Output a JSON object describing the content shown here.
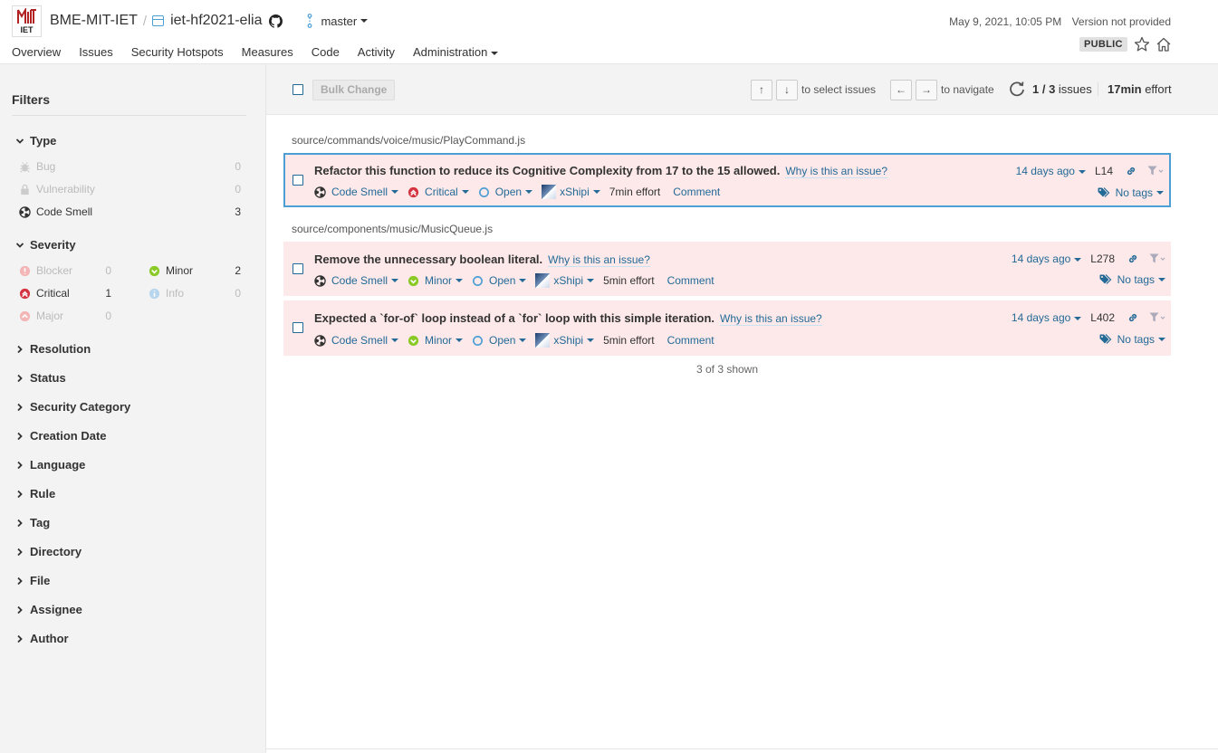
{
  "header": {
    "logo_text": "IET",
    "org": "BME-MIT-IET",
    "separator": "/",
    "project": "iet-hf2021-elia",
    "branch": "master",
    "date": "May 9, 2021, 10:05 PM",
    "version": "Version not provided",
    "visibility": "PUBLIC"
  },
  "nav": {
    "tabs": [
      "Overview",
      "Issues",
      "Security Hotspots",
      "Measures",
      "Code",
      "Activity",
      "Administration"
    ],
    "active": "Issues"
  },
  "sidebar": {
    "title": "Filters",
    "type": {
      "label": "Type",
      "items": [
        {
          "label": "Bug",
          "count": "0",
          "icon": "bug-icon"
        },
        {
          "label": "Vulnerability",
          "count": "0",
          "icon": "lock-icon"
        },
        {
          "label": "Code Smell",
          "count": "3",
          "icon": "code-smell-icon"
        }
      ]
    },
    "severity": {
      "label": "Severity",
      "items": [
        {
          "label": "Blocker",
          "count": "0"
        },
        {
          "label": "Minor",
          "count": "2"
        },
        {
          "label": "Critical",
          "count": "1"
        },
        {
          "label": "Info",
          "count": "0"
        },
        {
          "label": "Major",
          "count": "0"
        }
      ]
    },
    "collapsed": [
      "Resolution",
      "Status",
      "Security Category",
      "Creation Date",
      "Language",
      "Rule",
      "Tag",
      "Directory",
      "File",
      "Assignee",
      "Author"
    ]
  },
  "toolbar": {
    "bulk_change": "Bulk Change",
    "up_key": "↑",
    "down_key": "↓",
    "select_hint": "to select issues",
    "left_key": "←",
    "right_key": "→",
    "navigate_hint": "to navigate",
    "count_current": "1 / 3",
    "count_suffix": "issues",
    "effort_value": "17min",
    "effort_suffix": "effort"
  },
  "files": [
    "source/commands/voice/music/PlayCommand.js",
    "source/components/music/MusicQueue.js"
  ],
  "issues": [
    {
      "message": "Refactor this function to reduce its Cognitive Complexity from 17 to the 15 allowed.",
      "why": "Why is this an issue?",
      "type": "Code Smell",
      "severity": "Critical",
      "status": "Open",
      "assignee": "xShipi",
      "effort": "7min effort",
      "comment": "Comment",
      "date": "14 days ago",
      "line": "L14",
      "tags": "No tags"
    },
    {
      "message": "Remove the unnecessary boolean literal.",
      "why": "Why is this an issue?",
      "type": "Code Smell",
      "severity": "Minor",
      "status": "Open",
      "assignee": "xShipi",
      "effort": "5min effort",
      "comment": "Comment",
      "date": "14 days ago",
      "line": "L278",
      "tags": "No tags"
    },
    {
      "message": "Expected a `for-of` loop instead of a `for` loop with this simple iteration.",
      "why": "Why is this an issue?",
      "type": "Code Smell",
      "severity": "Minor",
      "status": "Open",
      "assignee": "xShipi",
      "effort": "5min effort",
      "comment": "Comment",
      "date": "14 days ago",
      "line": "L402",
      "tags": "No tags"
    }
  ],
  "footer": {
    "shown": "3 of 3 shown"
  },
  "colors": {
    "link": "#236a97",
    "accent": "#4b9fd5",
    "critical": "#d4333f",
    "minor": "#8ac926",
    "issue_bg": "#fde9e9"
  }
}
